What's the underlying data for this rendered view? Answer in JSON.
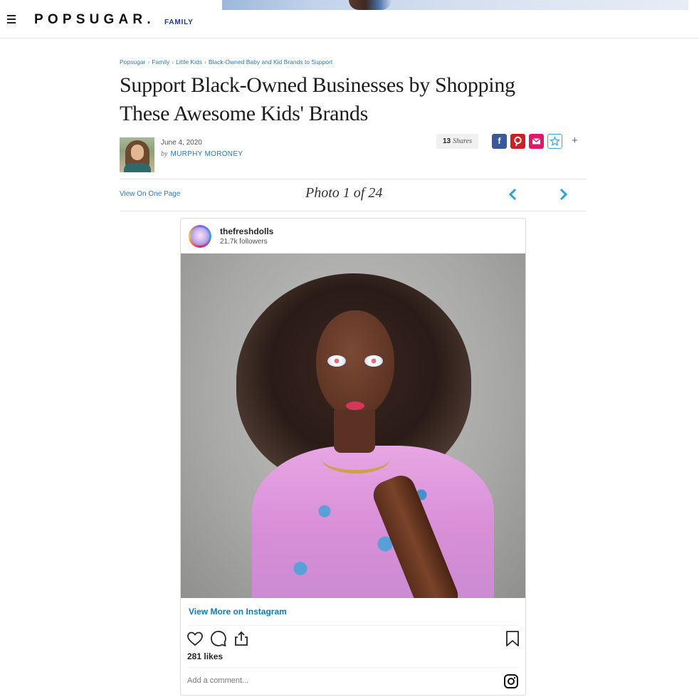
{
  "header": {
    "logo_text": "POPSUGAR.",
    "section_label": "FAMILY"
  },
  "breadcrumb": [
    "Popsugar",
    "Family",
    "Little Kids",
    "Black-Owned Baby and Kid Brands to Support"
  ],
  "article": {
    "title": "Support Black-Owned Businesses by Shopping These Awesome Kids' Brands",
    "date": "June 4, 2020",
    "by_label": "by",
    "author": "MURPHY MORONEY",
    "shares_count": "13",
    "shares_label": "Shares",
    "more_symbol": "+"
  },
  "gallery": {
    "view_one_page": "View On One Page",
    "photo_counter": "Photo 1 of 24"
  },
  "instagram": {
    "username": "thefreshdolls",
    "followers": "21.7k followers",
    "view_more": "View More on Instagram",
    "likes": "281 likes",
    "comment_placeholder": "Add a comment..."
  },
  "colors": {
    "link_blue": "#2a7ab8",
    "facebook": "#3b5998",
    "pinterest": "#cb2027",
    "email": "#e0176a",
    "save_outline": "#3aa7e0",
    "arrow": "#29a3d8"
  },
  "icons": {
    "menu": "hamburger-icon",
    "facebook": "facebook-icon",
    "pinterest": "pinterest-icon",
    "email": "envelope-icon",
    "save": "star-icon",
    "prev": "chevron-left-icon",
    "next": "chevron-right-icon",
    "like": "heart-icon",
    "comment": "speech-bubble-icon",
    "share": "share-icon",
    "bookmark": "bookmark-icon",
    "instagram": "instagram-logo-icon"
  }
}
